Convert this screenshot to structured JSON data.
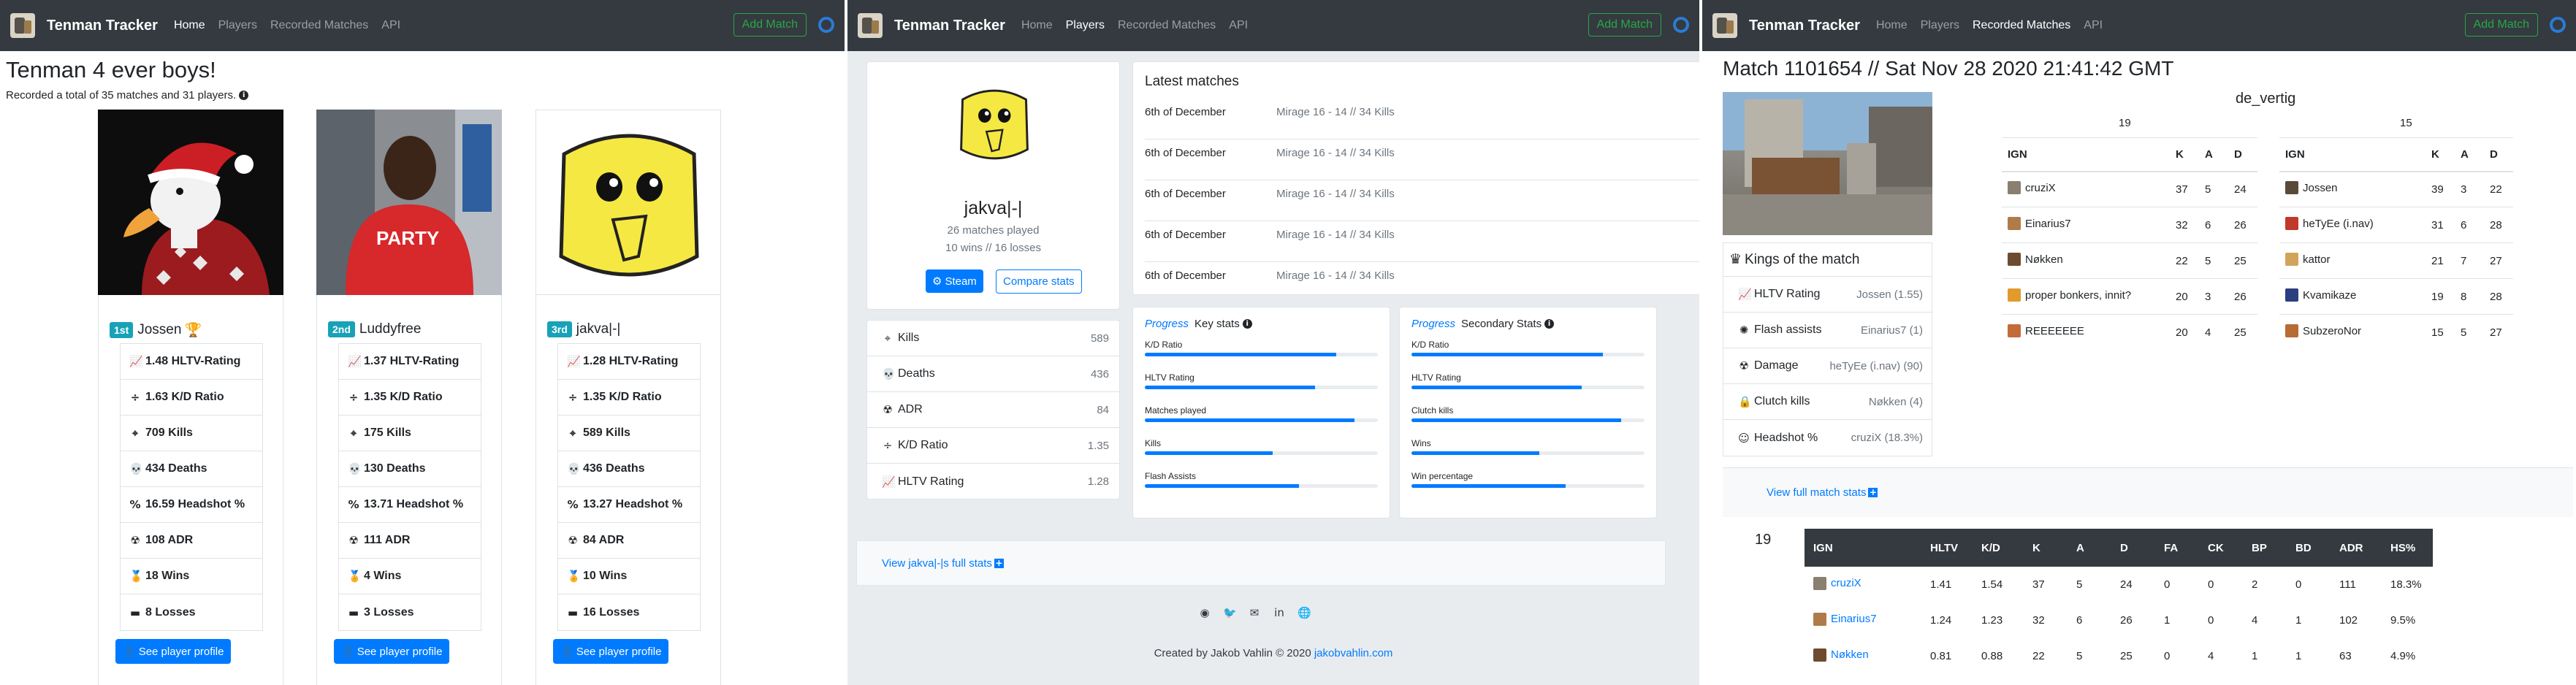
{
  "nav": {
    "brand": "Tenman Tracker",
    "links": [
      "Home",
      "Players",
      "Recorded Matches",
      "API"
    ],
    "add_match": "Add Match"
  },
  "home": {
    "title": "Tenman 4 ever boys!",
    "subtitle": "Recorded a total of 35 matches and 31 players.",
    "players": [
      {
        "rank": "1st",
        "name": "Jossen",
        "stats": [
          "1.48 HLTV-Rating",
          "1.63 K/D Ratio",
          "709 Kills",
          "434 Deaths",
          "16.59 Headshot %",
          "108 ADR",
          "18 Wins",
          "8 Losses"
        ],
        "button": "See player profile"
      },
      {
        "rank": "2nd",
        "name": "Luddyfree",
        "stats": [
          "1.37 HLTV-Rating",
          "1.35 K/D Ratio",
          "175 Kills",
          "130 Deaths",
          "13.71 Headshot %",
          "111 ADR",
          "4 Wins",
          "3 Losses"
        ],
        "button": "See player profile"
      },
      {
        "rank": "3rd",
        "name": "jakva|-|",
        "stats": [
          "1.28 HLTV-Rating",
          "1.35 K/D Ratio",
          "589 Kills",
          "436 Deaths",
          "13.27 Headshot %",
          "84 ADR",
          "10 Wins",
          "16 Losses"
        ],
        "button": "See player profile"
      }
    ]
  },
  "player": {
    "name": "jakva|-|",
    "matches": "26 matches played",
    "record": "10 wins // 16 losses",
    "steam": "Steam",
    "compare": "Compare stats",
    "latest_title": "Latest matches",
    "latest": [
      {
        "date": "6th of December",
        "info": "Mirage 16 - 14 // 34 Kills"
      },
      {
        "date": "6th of December",
        "info": "Mirage 16 - 14 // 34 Kills"
      },
      {
        "date": "6th of December",
        "info": "Mirage 16 - 14 // 34 Kills"
      },
      {
        "date": "6th of December",
        "info": "Mirage 16 - 14 // 34 Kills"
      },
      {
        "date": "6th of December",
        "info": "Mirage 16 - 14 // 34 Kills"
      }
    ],
    "summary": [
      {
        "label": "Kills",
        "value": "589"
      },
      {
        "label": "Deaths",
        "value": "436"
      },
      {
        "label": "ADR",
        "value": "84"
      },
      {
        "label": "K/D Ratio",
        "value": "1.35"
      },
      {
        "label": "HLTV Rating",
        "value": "1.28"
      }
    ],
    "key_stats": {
      "tag": "Progress",
      "title": "Key stats",
      "items": [
        {
          "label": "K/D Ratio",
          "pct": 82
        },
        {
          "label": "HLTV Rating",
          "pct": 73
        },
        {
          "label": "Matches played",
          "pct": 90
        },
        {
          "label": "Kills",
          "pct": 55
        },
        {
          "label": "Flash Assists",
          "pct": 66
        }
      ]
    },
    "secondary_stats": {
      "tag": "Progress",
      "title": "Secondary Stats",
      "items": [
        {
          "label": "K/D Ratio",
          "pct": 82
        },
        {
          "label": "HLTV Rating",
          "pct": 73
        },
        {
          "label": "Clutch kills",
          "pct": 90
        },
        {
          "label": "Wins",
          "pct": 55
        },
        {
          "label": "Win percentage",
          "pct": 66
        }
      ]
    },
    "full_stats_link": "View jakva|-|s full stats",
    "footer_text": "Created by Jakob Vahlin © 2020",
    "footer_link": "jakobvahlin.com"
  },
  "match": {
    "title": "Match 1101654 // Sat Nov 28 2020 21:41:42 GMT",
    "map": "de_vertig",
    "kings_title": "Kings of the match",
    "kings": [
      {
        "label": "HLTV Rating",
        "value": "Jossen (1.55)"
      },
      {
        "label": "Flash assists",
        "value": "Einarius7 (1)"
      },
      {
        "label": "Damage",
        "value": "heTyEe (i.nav) (90)"
      },
      {
        "label": "Clutch kills",
        "value": "Nøkken (4)"
      },
      {
        "label": "Headshot %",
        "value": "cruziX (18.3%)"
      }
    ],
    "team1": {
      "score": "19",
      "headers": [
        "IGN",
        "K",
        "A",
        "D"
      ],
      "rows": [
        [
          "cruziX",
          "37",
          "5",
          "24"
        ],
        [
          "Einarius7",
          "32",
          "6",
          "26"
        ],
        [
          "Nøkken",
          "22",
          "5",
          "25"
        ],
        [
          "proper bonkers, innit?",
          "20",
          "3",
          "26"
        ],
        [
          "REEEEEEE",
          "20",
          "4",
          "25"
        ]
      ]
    },
    "team2": {
      "score": "15",
      "headers": [
        "IGN",
        "K",
        "A",
        "D"
      ],
      "rows": [
        [
          "Jossen",
          "39",
          "3",
          "22"
        ],
        [
          "heTyEe (i.nav)",
          "31",
          "6",
          "28"
        ],
        [
          "kattor",
          "21",
          "7",
          "27"
        ],
        [
          "Kvamikaze",
          "19",
          "8",
          "28"
        ],
        [
          "SubzeroNor",
          "15",
          "5",
          "27"
        ]
      ]
    },
    "full_stats_link": "View full match stats",
    "detail": {
      "team_score": "19",
      "headers": [
        "IGN",
        "HLTV",
        "K/D",
        "K",
        "A",
        "D",
        "FA",
        "CK",
        "BP",
        "BD",
        "ADR",
        "HS%"
      ],
      "rows": [
        [
          "cruziX",
          "1.41",
          "1.54",
          "37",
          "5",
          "24",
          "0",
          "0",
          "2",
          "0",
          "111",
          "18.3%"
        ],
        [
          "Einarius7",
          "1.24",
          "1.23",
          "32",
          "6",
          "26",
          "1",
          "0",
          "4",
          "1",
          "102",
          "9.5%"
        ],
        [
          "Nøkken",
          "0.81",
          "0.88",
          "22",
          "5",
          "25",
          "0",
          "4",
          "1",
          "1",
          "63",
          "4.9%"
        ]
      ]
    }
  },
  "colors": {
    "navbar": "#343a40",
    "primary": "#007bff",
    "success": "#28a745",
    "rank": "#17a2b8"
  }
}
